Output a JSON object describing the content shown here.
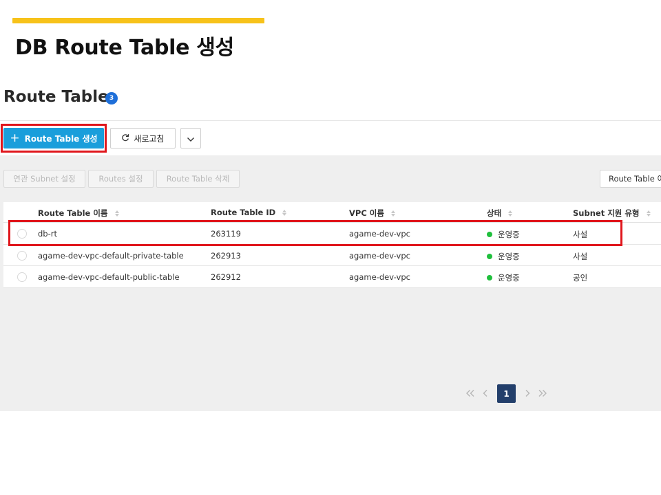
{
  "slide": {
    "title": "DB Route Table 생성"
  },
  "panel": {
    "title": "Route Table",
    "count": "3"
  },
  "toolbar": {
    "create_label": "Route Table 생성",
    "refresh_label": "새로고침"
  },
  "actions": {
    "subnet_settings": "연관 Subnet 설정",
    "routes_settings": "Routes 설정",
    "delete": "Route Table 삭제"
  },
  "filter": {
    "selected": "Route Table 이름"
  },
  "table": {
    "columns": [
      "Route Table 이름",
      "Route Table ID",
      "VPC 이름",
      "상태",
      "Subnet 지원 유형"
    ],
    "rows": [
      {
        "name": "db-rt",
        "id": "263119",
        "vpc": "agame-dev-vpc",
        "status": "운영중",
        "subnet_type": "사설"
      },
      {
        "name": "agame-dev-vpc-default-private-table",
        "id": "262913",
        "vpc": "agame-dev-vpc",
        "status": "운영중",
        "subnet_type": "사설"
      },
      {
        "name": "agame-dev-vpc-default-public-table",
        "id": "262912",
        "vpc": "agame-dev-vpc",
        "status": "운영중",
        "subnet_type": "공인"
      }
    ]
  },
  "pagination": {
    "current_page": "1"
  },
  "colors": {
    "accent_bar": "#f7c21a",
    "primary_button": "#1a9edb",
    "highlight_box": "#e0161c",
    "status_running": "#1fbf3c",
    "page_current": "#233f6b"
  },
  "icons": {
    "create": "plus-icon",
    "refresh": "refresh-icon",
    "more": "chevron-down-icon",
    "sort": "sort-icon",
    "pager": [
      "double-chevron-left-icon",
      "chevron-left-icon",
      "chevron-right-icon",
      "double-chevron-right-icon"
    ]
  }
}
